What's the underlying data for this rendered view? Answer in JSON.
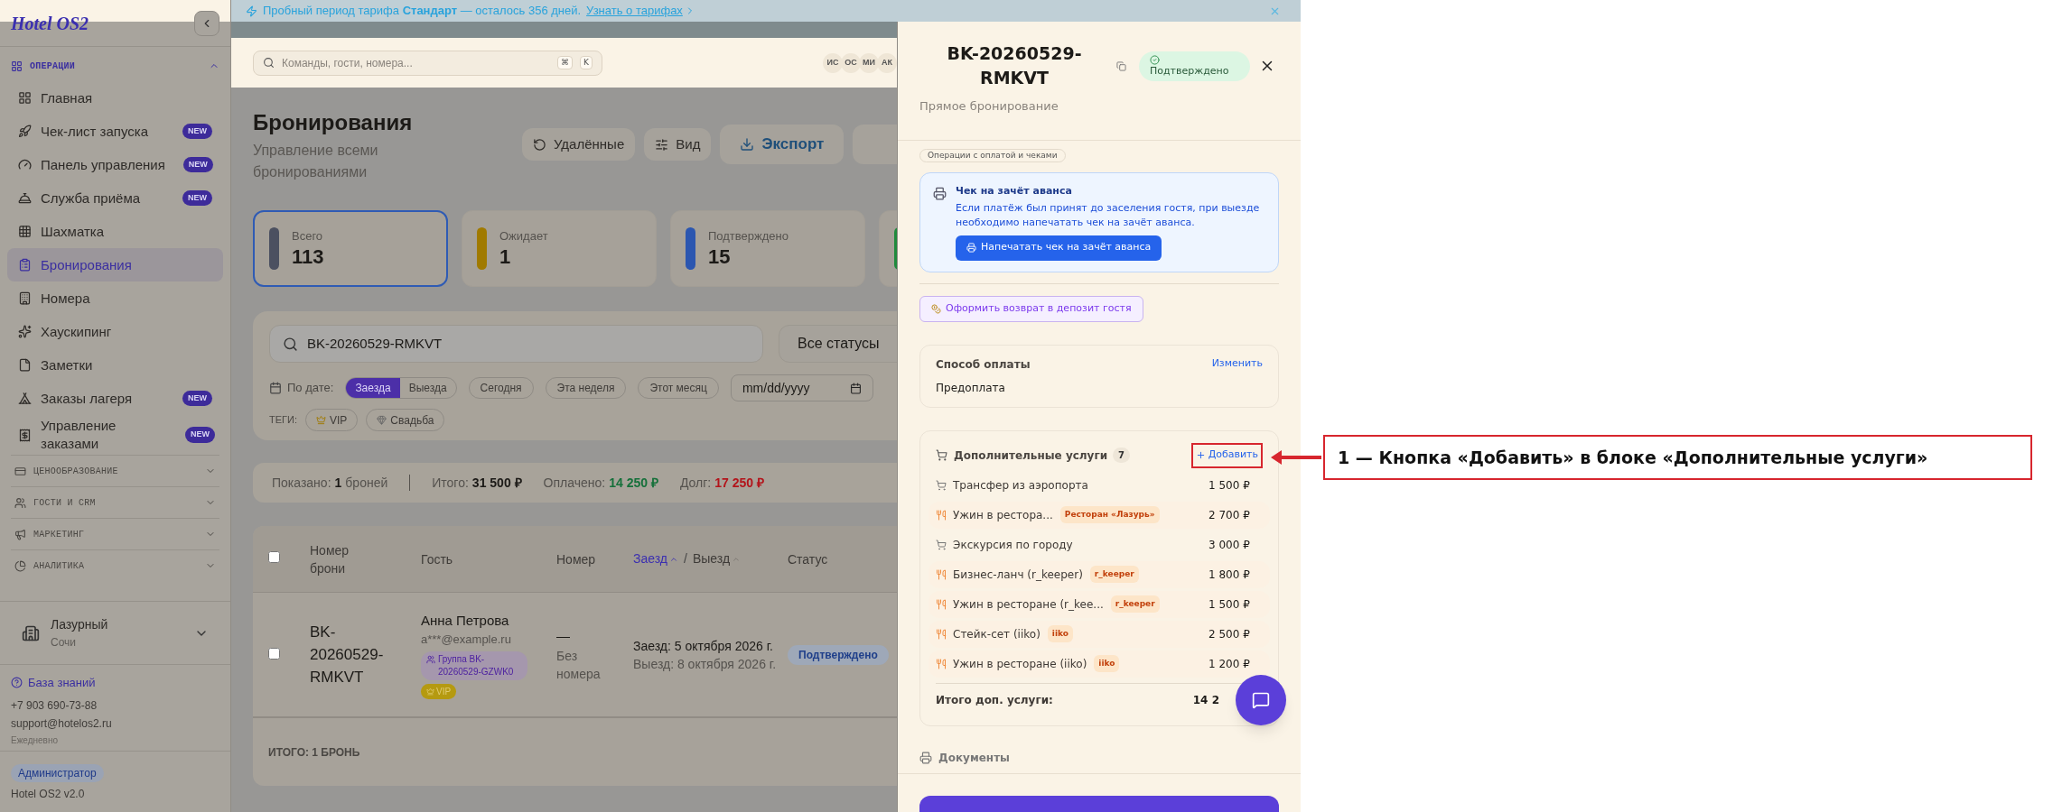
{
  "banner": {
    "text": "Пробный период тарифа **Стандарт** — осталось 356 дней.",
    "link": "Узнать о тарифах"
  },
  "sidebar": {
    "logo": "Hotel OS2",
    "groups": [
      {
        "label": "ОПЕРАЦИИ",
        "expanded": true,
        "items": [
          {
            "label": "Главная",
            "selected": false
          },
          {
            "label": "Чек-лист запуска",
            "selected": false,
            "badge": "NEW"
          },
          {
            "label": "Панель управления",
            "selected": false,
            "badge": "NEW"
          },
          {
            "label": "Служба приёма",
            "selected": false,
            "badge": "NEW"
          },
          {
            "label": "Шахматка",
            "selected": false
          },
          {
            "label": "Бронирования",
            "selected": true
          },
          {
            "label": "Номера",
            "selected": false
          },
          {
            "label": "Хаускипинг",
            "selected": false
          },
          {
            "label": "Заметки",
            "selected": false
          },
          {
            "label": "Заказы лагеря",
            "selected": false,
            "badge": "NEW"
          },
          {
            "label": "Управление заказами",
            "selected": false,
            "badge": "NEW"
          }
        ]
      },
      {
        "label": "ЦЕНООБРАЗОВАНИЕ",
        "expanded": false
      },
      {
        "label": "ГОСТИ И CRM",
        "expanded": false
      },
      {
        "label": "МАРКЕТИНГ",
        "expanded": false
      },
      {
        "label": "АНАЛИТИКА",
        "expanded": false
      }
    ],
    "hotel": {
      "name": "Лазурный",
      "city": "Сочи"
    },
    "help": {
      "link": "База знаний",
      "phone": "+7 903 690-73-88",
      "email": "support@hotelos2.ru",
      "hours": "Ежедневно"
    },
    "role": "Администратор",
    "version": "Hotel OS2 v2.0"
  },
  "header": {
    "search": {
      "placeholder": "Команды, гости, номера..."
    },
    "keys": [
      "⌘",
      "K"
    ],
    "avatars": [
      "ИС",
      "ОС",
      "МИ",
      "АК"
    ]
  },
  "page": {
    "title": "Бронирования",
    "subtitle": "Управление всеми бронированиями",
    "actions": [
      {
        "kind": "secondary",
        "label": "Удалённые"
      },
      {
        "kind": "view",
        "label": "Вид"
      },
      {
        "kind": "export",
        "label": "Экспорт"
      },
      {
        "kind": "partial"
      }
    ]
  },
  "stats": [
    {
      "label": "Всего",
      "value": "113",
      "color": "#4b5060",
      "selected": true
    },
    {
      "label": "Ожидает",
      "value": "1",
      "color": "#a07a00",
      "selected": false
    },
    {
      "label": "Подтверждено",
      "value": "15",
      "color": "#2b56b0",
      "selected": false
    },
    {
      "color": "#1f8a3c",
      "selected": false
    }
  ],
  "filters": {
    "search": {
      "value": "BK-20260529-RMKVT"
    },
    "status": "Все статусы",
    "date_label": "По дате:",
    "date_modes": [
      {
        "label": "Заезда",
        "selected": true
      },
      {
        "label": "Выезда",
        "selected": false
      }
    ],
    "presets": [
      {
        "label": "Сегодня",
        "selected": false
      },
      {
        "label": "Эта неделя",
        "selected": false
      },
      {
        "label": "Этот месяц",
        "selected": false
      }
    ],
    "date_field": {
      "placeholder": "mm/dd/yyyy"
    },
    "tags_label": "ТЕГИ:",
    "tags": [
      {
        "label": "VIP"
      },
      {
        "label": "Свадьба"
      }
    ]
  },
  "summary": [
    {
      "label": "Показано:",
      "value": "1",
      "suffix": "броней",
      "color": "#1c1a17"
    },
    {
      "label": "Итого:",
      "value": "31 500 ₽",
      "color": "#1c1a17"
    },
    {
      "label": "Оплачено:",
      "value": "14 250 ₽",
      "color": "#15703a"
    },
    {
      "label": "Долг:",
      "value": "17 250 ₽",
      "color": "#b3141b"
    }
  ],
  "table": {
    "select_all": {
      "checked": false
    },
    "columns": [
      {
        "kind": "text",
        "label": "Номер брони"
      },
      {
        "kind": "text",
        "label": "Гость"
      },
      {
        "kind": "text",
        "label": "Номер"
      },
      {
        "kind": "sort",
        "separator": "/",
        "labels": [
          {
            "label": "Заезд",
            "selected": true
          },
          {
            "label": "Выезд",
            "selected": false
          }
        ]
      },
      {
        "kind": "text",
        "label": "Статус"
      }
    ],
    "rows": [
      {
        "checked": false,
        "booking": "BK-20260529-RMKVT",
        "guest": "Анна Петрова",
        "email": "a***@example.ru",
        "group": "Группа BK-20260529-GZWK0",
        "tag": "VIP",
        "room": "—",
        "room_note": "Без номера",
        "checkin": "Заезд: 5 октября 2026 г.",
        "checkout": "Выезд: 8 октября 2026 г.",
        "status": "Подтверждено"
      }
    ],
    "footer": "ИТОГО: 1 БРОНЬ"
  },
  "drawer": {
    "title": "BK-20260529-RMKVT",
    "status": "Подтверждено",
    "subtitle": "Прямое бронирование",
    "section_chip": "Операции с оплатой и чеками",
    "receipt": {
      "title": "Чек на зачёт аванса",
      "text": "Если платёж был принят до заселения гостя, при выезде необходимо напечатать чек на зачёт аванса.",
      "button": "Напечатать чек на зачёт аванса"
    },
    "deposit_button": "Оформить возврат в депозит гостя",
    "payment": {
      "title": "Способ оплаты",
      "action": "Изменить",
      "value": "Предоплата"
    },
    "extras": {
      "title": "Дополнительные услуги",
      "count": "7",
      "add": "Добавить",
      "highlighted": true,
      "items": [
        {
          "kind": "service",
          "name": "Трансфер из аэропорта",
          "price": "1 500 ₽"
        },
        {
          "kind": "restaurant",
          "name": "Ужин в рестора...",
          "tag": "Ресторан «Лазурь»",
          "price": "2 700 ₽"
        },
        {
          "kind": "service",
          "name": "Экскурсия по городу",
          "price": "3 000 ₽"
        },
        {
          "kind": "restaurant",
          "name": "Бизнес-ланч (r_keeper)",
          "tag": "r_keeper",
          "price": "1 800 ₽"
        },
        {
          "kind": "restaurant",
          "name": "Ужин в ресторане (r_kee...",
          "tag": "r_keeper",
          "price": "1 500 ₽"
        },
        {
          "kind": "restaurant",
          "name": "Стейк-сет (iiko)",
          "tag": "iiko",
          "price": "2 500 ₽"
        },
        {
          "kind": "restaurant",
          "name": "Ужин в ресторане (iiko)",
          "tag": "iiko",
          "price": "1 200 ₽"
        }
      ],
      "total_label": "Итого доп. услуги:",
      "total": "14 2"
    },
    "documents": "Документы"
  },
  "annotation": {
    "text": "1 — Кнопка «Добавить» в блоке «Дополнительные услуги»"
  }
}
